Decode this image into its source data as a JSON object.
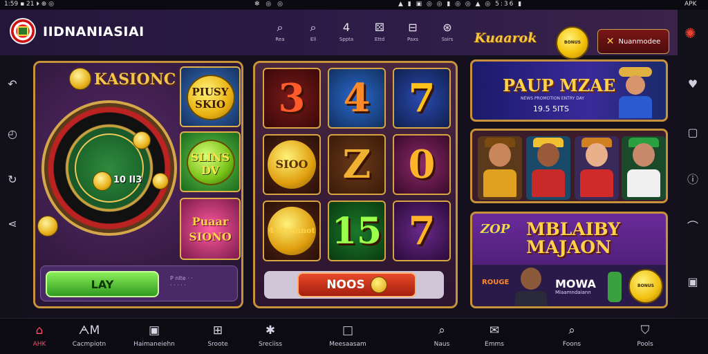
{
  "status_bar": {
    "left": "1:59 ▪ 21 ⏵ ⊕ ◎",
    "mid": "✻ ◎ ◎",
    "right": "▲ ▮ ▣ ◎ ◎ ▮ ◎ ◎ ▲ ◎ 5:36 ▮",
    "apk": "APK"
  },
  "header": {
    "title": "IIDNANIASIAI",
    "nav": [
      {
        "icon": "search-icon",
        "glyph": "⌕",
        "label": "Rea"
      },
      {
        "icon": "search-icon",
        "glyph": "⌕",
        "label": "Ell"
      },
      {
        "icon": "number-icon",
        "glyph": "4",
        "label": "Sppta"
      },
      {
        "icon": "dice-icon",
        "glyph": "⚄",
        "label": "Ettd"
      },
      {
        "icon": "ticket-icon",
        "glyph": "⊟",
        "label": "Paxs"
      },
      {
        "icon": "target-icon",
        "glyph": "⊛",
        "label": "Ssirs"
      }
    ],
    "brand": "Kuaarok",
    "coin_button": "BONUS",
    "close_promo": "Nuanmodee",
    "accent": "#f5c542"
  },
  "left_panel": {
    "title": "KASIONC",
    "wheel_number": "10 II3",
    "tiles": [
      "PIUSY SKIO",
      "SLINS DV",
      "Puaar SIONO"
    ],
    "play_button": "LAY",
    "play_note": "P nlte · ·\n· · · · ·"
  },
  "middle_panel": {
    "reels": [
      "3",
      "4",
      "7",
      "SIOO",
      "Z",
      "0",
      "4 Maunnot",
      "15",
      "7"
    ],
    "spin_button": "NOOS"
  },
  "right_column": {
    "banner1": {
      "title": "PAUP MZAE",
      "sub1": "NEWS PROMOTION ENTRY DAY",
      "sub2": "19.5 5ITS"
    },
    "banner3": {
      "zop": "ZOP",
      "line1": "MBLAIBY",
      "line2": "MAJAON",
      "rouge": "ROUGE",
      "mowa": "MOWA",
      "mowa_sub": "Mlaamndaiann",
      "coin": "BONUS"
    }
  },
  "bottom_nav": [
    {
      "icon": "home-icon",
      "glyph": "⌂",
      "label": "AHK",
      "active": true
    },
    {
      "icon": "logo-icon",
      "glyph": "ᗅM",
      "label": "Cacmpiotn",
      "active": false
    },
    {
      "icon": "card-icon",
      "glyph": "▣",
      "label": "Haimaneiehn",
      "active": false
    },
    {
      "icon": "grid-icon",
      "glyph": "⊞",
      "label": "Sroote",
      "active": false
    },
    {
      "icon": "gear-icon",
      "glyph": "✱",
      "label": "Sreciiss",
      "active": false
    },
    {
      "icon": "square-icon",
      "glyph": "□",
      "label": "Meesaasam",
      "active": false
    },
    {
      "icon": "search-icon",
      "glyph": "⌕",
      "label": "Naus",
      "active": false
    },
    {
      "icon": "chat-icon",
      "glyph": "✉",
      "label": "Emms",
      "active": false
    },
    {
      "icon": "search-icon",
      "glyph": "⌕",
      "label": "Foons",
      "active": false
    },
    {
      "icon": "shield-icon",
      "glyph": "⛉",
      "label": "Pools",
      "active": false
    }
  ]
}
